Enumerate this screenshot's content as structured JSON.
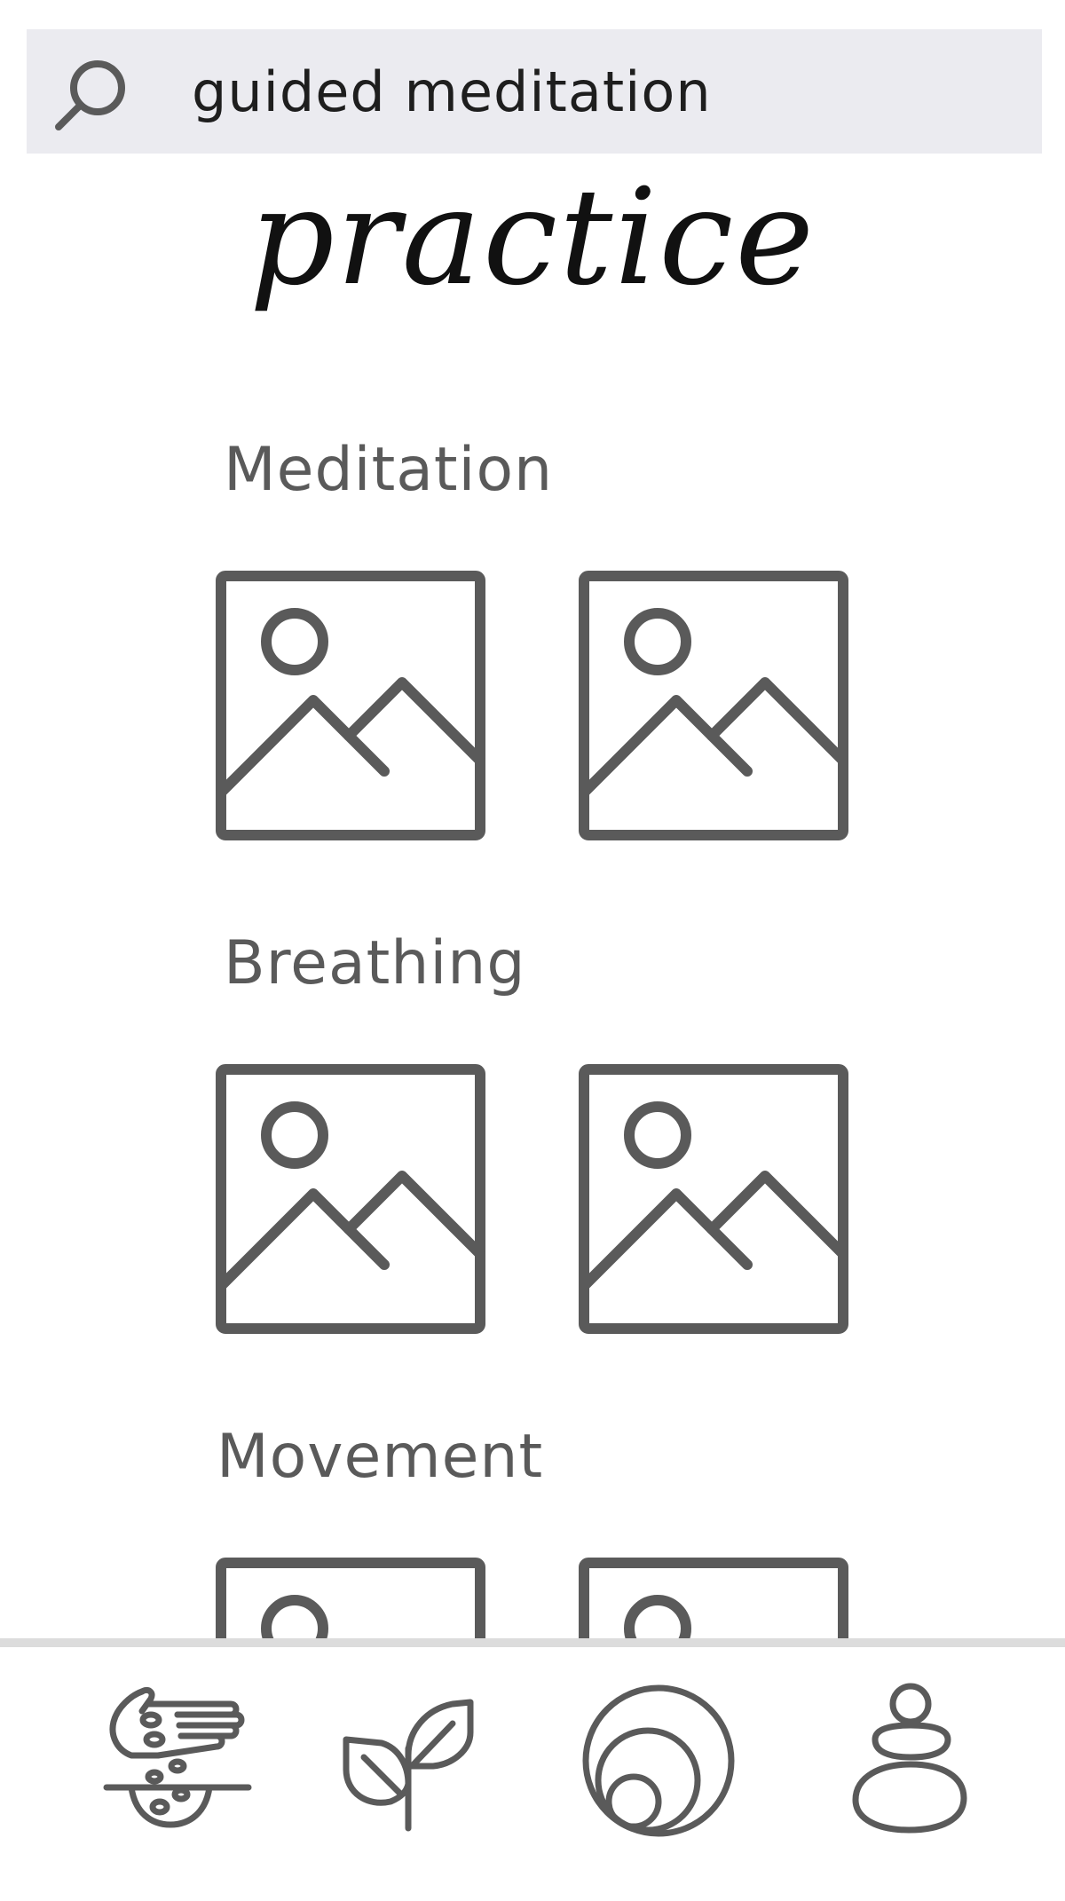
{
  "search": {
    "value": "guided meditation",
    "icon": "search-icon"
  },
  "page": {
    "title": "practice"
  },
  "sections": [
    {
      "title": "Meditation",
      "items": [
        {
          "icon": "image-placeholder-icon"
        },
        {
          "icon": "image-placeholder-icon"
        }
      ]
    },
    {
      "title": "Breathing",
      "items": [
        {
          "icon": "image-placeholder-icon"
        },
        {
          "icon": "image-placeholder-icon"
        }
      ]
    },
    {
      "title": "Movement",
      "items": [
        {
          "icon": "image-placeholder-icon"
        },
        {
          "icon": "image-placeholder-icon"
        }
      ]
    }
  ],
  "bottom_nav": {
    "items": [
      {
        "icon": "hand-seeds-icon"
      },
      {
        "icon": "sprout-icon"
      },
      {
        "icon": "concentric-circles-icon"
      },
      {
        "icon": "stacked-stones-icon"
      }
    ]
  },
  "colors": {
    "icon_gray": "#5a5a5a",
    "search_bg": "#ebebf0",
    "title_black": "#111111",
    "nav_border": "#dcdcdc"
  }
}
